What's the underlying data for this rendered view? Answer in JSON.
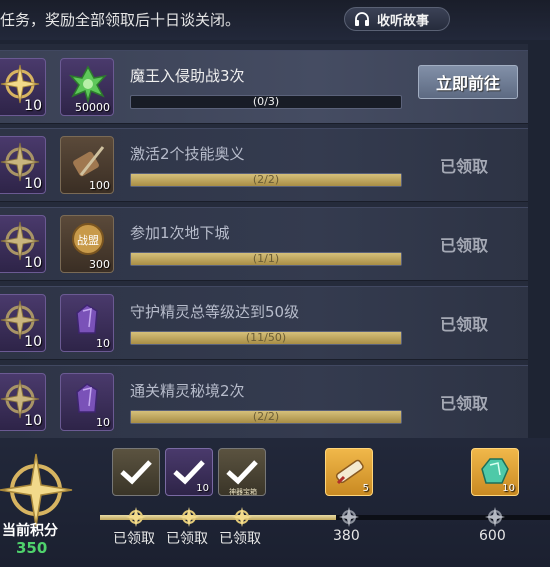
{
  "header": {
    "notice": "任务，奖励全部领取后十日谈关闭。",
    "listen_button": "收听故事",
    "listen_icon": "headphones-icon"
  },
  "tasks": [
    {
      "title": "魔王入侵助战3次",
      "progress_text": "(0/3)",
      "progress": 0.0,
      "reward1_qty": "10",
      "reward2_qty": "50000",
      "reward2_icon": "green-crystal-icon",
      "status": "立即前往",
      "claimed": false
    },
    {
      "title": "激活2个技能奥义",
      "progress_text": "(2/2)",
      "progress": 1.0,
      "reward1_qty": "10",
      "reward2_qty": "100",
      "reward2_icon": "sword-scroll-icon",
      "status": "已领取",
      "claimed": true
    },
    {
      "title": "参加1次地下城",
      "progress_text": "(1/1)",
      "progress": 1.0,
      "reward1_qty": "10",
      "reward2_qty": "300",
      "reward2_icon": "guild-coin-icon",
      "reward2_label": "战盟",
      "status": "已领取",
      "claimed": true
    },
    {
      "title": "守护精灵总等级达到50级",
      "progress_text": "(11/50)",
      "progress": 1.0,
      "reward1_qty": "10",
      "reward2_qty": "10",
      "reward2_icon": "purple-stone-icon",
      "status": "已领取",
      "claimed": true
    },
    {
      "title": "通关精灵秘境2次",
      "progress_text": "(2/2)",
      "progress": 1.0,
      "reward1_qty": "10",
      "reward2_qty": "10",
      "reward2_icon": "purple-stone-icon",
      "status": "已领取",
      "claimed": true
    }
  ],
  "score": {
    "label": "当前积分",
    "value": "350"
  },
  "milestones": [
    {
      "label": "已领取",
      "claimed": true,
      "reward_qty": "",
      "reward_icon": "purple-item-icon"
    },
    {
      "label": "已领取",
      "claimed": true,
      "reward_qty": "10",
      "reward_icon": "purple-stone-icon"
    },
    {
      "label": "已领取",
      "claimed": true,
      "reward_qty": "",
      "reward_icon": "scroll-icon",
      "reward_caption": "神器宝箱"
    },
    {
      "label": "380",
      "claimed": false,
      "reward_qty": "5",
      "reward_icon": "scroll-icon"
    },
    {
      "label": "600",
      "claimed": false,
      "reward_qty": "10",
      "reward_icon": "green-crystal-icon"
    }
  ],
  "colors": {
    "accent_gold": "#d6c07a",
    "score_green": "#4fd26c",
    "panel_bg": "#252b3b"
  }
}
